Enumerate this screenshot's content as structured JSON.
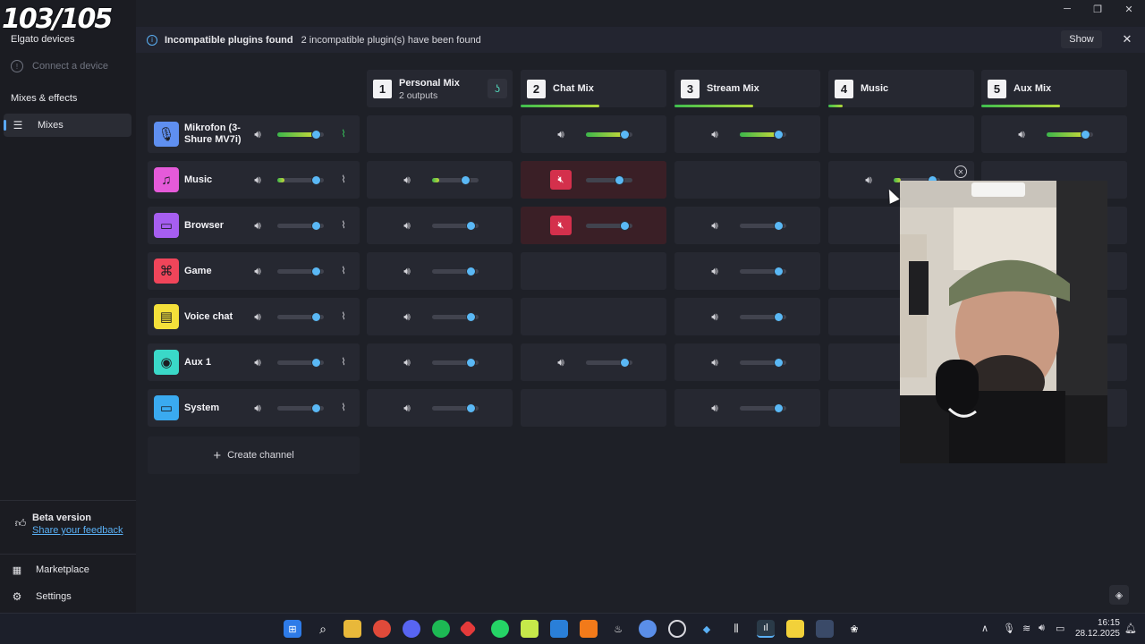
{
  "overlay": {
    "episode_counter": "103/105"
  },
  "sidebar": {
    "section_devices": "Elgato devices",
    "connect_device": "Connect a device",
    "section_mixes": "Mixes & effects",
    "mixes_item": "Mixes",
    "beta_title": "Beta version",
    "feedback_link": "Share your feedback",
    "marketplace": "Marketplace",
    "settings": "Settings"
  },
  "notice": {
    "title": "Incompatible plugins found",
    "message": "2 incompatible plugin(s) have been found",
    "show_label": "Show"
  },
  "mixes": [
    {
      "num": "1",
      "name": "Personal Mix",
      "sub": "2 outputs",
      "level": 0
    },
    {
      "num": "2",
      "name": "Chat Mix",
      "sub": "",
      "level": 0.54
    },
    {
      "num": "3",
      "name": "Stream Mix",
      "sub": "",
      "level": 0.54
    },
    {
      "num": "4",
      "name": "Music",
      "sub": "",
      "level": 0.1
    },
    {
      "num": "5",
      "name": "Aux Mix",
      "sub": "",
      "level": 0.54
    }
  ],
  "channels": [
    {
      "name": "Mikrofon (3- Shure MV7i)",
      "color": "#5f8ff0",
      "icon": "microphone-icon",
      "level": 0.82,
      "meter": 0.82,
      "live": true,
      "cells": [
        null,
        {
          "level": 0.82,
          "meter": 0.82
        },
        {
          "level": 0.82,
          "meter": 0.82
        },
        null,
        {
          "level": 0.82,
          "meter": 0.82
        }
      ]
    },
    {
      "name": "Music",
      "color": "#e55ad9",
      "icon": "music-note-icon",
      "level": 0.82,
      "meter": 0.15,
      "live": false,
      "cells": [
        {
          "level": 0.71,
          "meter": 0.15
        },
        {
          "level": 0.71,
          "muted": true
        },
        null,
        {
          "level": 0.82,
          "meter": 0.15
        },
        null
      ]
    },
    {
      "name": "Browser",
      "color": "#a65ef0",
      "icon": "browser-window-icon",
      "level": 0.82,
      "live": false,
      "cells": [
        {
          "level": 0.82
        },
        {
          "level": 0.82,
          "muted": true
        },
        {
          "level": 0.82
        },
        null,
        null
      ]
    },
    {
      "name": "Game",
      "color": "#f0455a",
      "icon": "gamepad-icon",
      "level": 0.82,
      "live": false,
      "cells": [
        {
          "level": 0.82
        },
        null,
        {
          "level": 0.82
        },
        null,
        null
      ]
    },
    {
      "name": "Voice chat",
      "color": "#f4e03a",
      "icon": "chat-bubble-icon",
      "level": 0.82,
      "live": false,
      "cells": [
        {
          "level": 0.82
        },
        null,
        {
          "level": 0.82
        },
        null,
        null
      ]
    },
    {
      "name": "Aux 1",
      "color": "#3ad8c8",
      "icon": "aux-circle-icon",
      "level": 0.82,
      "live": false,
      "cells": [
        {
          "level": 0.82
        },
        {
          "level": 0.82
        },
        {
          "level": 0.82
        },
        null,
        null
      ]
    },
    {
      "name": "System",
      "color": "#3aaaf0",
      "icon": "monitor-icon",
      "level": 0.82,
      "live": false,
      "cells": [
        {
          "level": 0.82
        },
        null,
        {
          "level": 0.82
        },
        null,
        null
      ]
    }
  ],
  "create_channel": "Create channel",
  "taskbar": {
    "clock_time": "16:15",
    "clock_date": "28.12.2025"
  }
}
